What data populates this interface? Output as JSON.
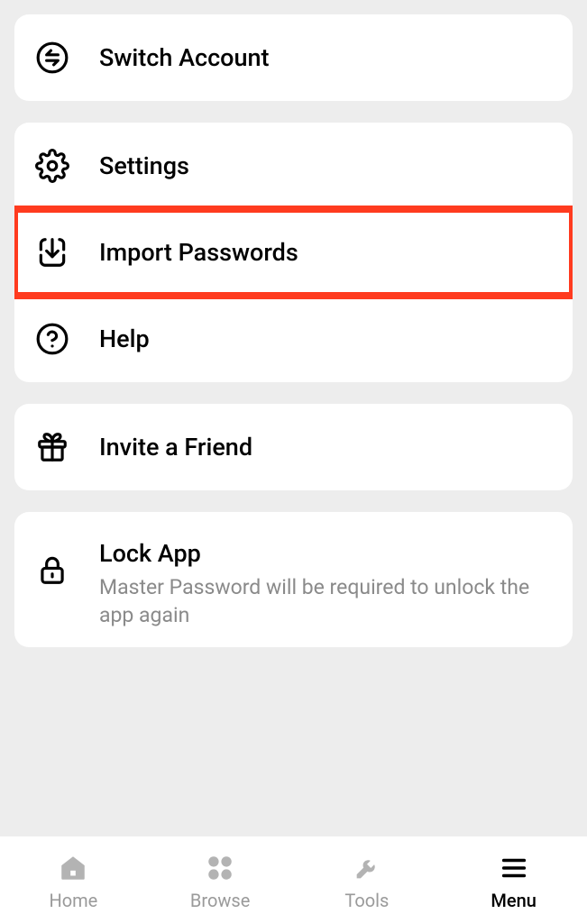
{
  "menu": {
    "switch_account": {
      "label": "Switch Account"
    },
    "settings": {
      "label": "Settings"
    },
    "import_passwords": {
      "label": "Import Passwords"
    },
    "help": {
      "label": "Help"
    },
    "invite_friend": {
      "label": "Invite a Friend"
    },
    "lock_app": {
      "label": "Lock App",
      "subtitle": "Master Password will be required to unlock the app again"
    }
  },
  "nav": {
    "home": {
      "label": "Home"
    },
    "browse": {
      "label": "Browse"
    },
    "tools": {
      "label": "Tools"
    },
    "menu": {
      "label": "Menu"
    }
  }
}
